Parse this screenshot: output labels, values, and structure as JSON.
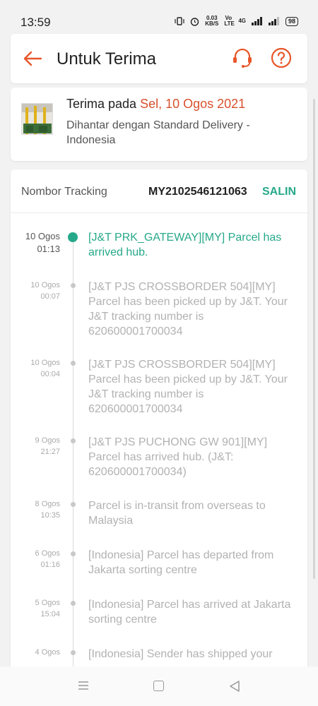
{
  "status_bar": {
    "time": "13:59",
    "net_speed_value": "0.03",
    "net_speed_unit": "KB/S",
    "volte_label": "Vo LTE",
    "network_label": "4G",
    "battery": "98"
  },
  "header": {
    "title": "Untuk Terima",
    "back_icon": "arrow-left-icon",
    "support_icon": "headset-icon",
    "help_icon": "question-circle-icon"
  },
  "delivery": {
    "received_label": "Terima pada",
    "received_date": "Sel, 10 Ogos 2021",
    "method_text": "Dihantar dengan Standard Delivery - Indonesia"
  },
  "tracking": {
    "label": "Nombor Tracking",
    "number": "MY2102546121063",
    "copy_label": "SALIN",
    "events": [
      {
        "date": "10 Ogos",
        "time": "01:13",
        "text": "[J&T PRK_GATEWAY][MY] Parcel has arrived hub.",
        "active": true
      },
      {
        "date": "10 Ogos",
        "time": "00:07",
        "text": "[J&T PJS CROSSBORDER 504][MY] Parcel has been picked up by J&T. Your J&T tracking number is 620600001700034",
        "active": false
      },
      {
        "date": "10 Ogos",
        "time": "00:04",
        "text": "[J&T PJS CROSSBORDER 504][MY] Parcel has been picked up by J&T. Your J&T tracking number is 620600001700034",
        "active": false
      },
      {
        "date": "9 Ogos",
        "time": "21:27",
        "text": "[J&T PJS PUCHONG GW 901][MY] Parcel has arrived hub. (J&T: 620600001700034)",
        "active": false
      },
      {
        "date": "8 Ogos",
        "time": "10:35",
        "text": "Parcel is in-transit from overseas to Malaysia",
        "active": false
      },
      {
        "date": "6 Ogos",
        "time": "01:16",
        "text": "[Indonesia] Parcel has departed from Jakarta sorting centre",
        "active": false
      },
      {
        "date": "5 Ogos",
        "time": "15:04",
        "text": "[Indonesia] Parcel has arrived at Jakarta sorting centre",
        "active": false
      },
      {
        "date": "4 Ogos",
        "time": "",
        "text": "[Indonesia] Sender has shipped your",
        "active": false
      }
    ]
  },
  "colors": {
    "accent_orange": "#e8562a",
    "accent_green": "#26a98a",
    "date_red": "#d9502e"
  }
}
